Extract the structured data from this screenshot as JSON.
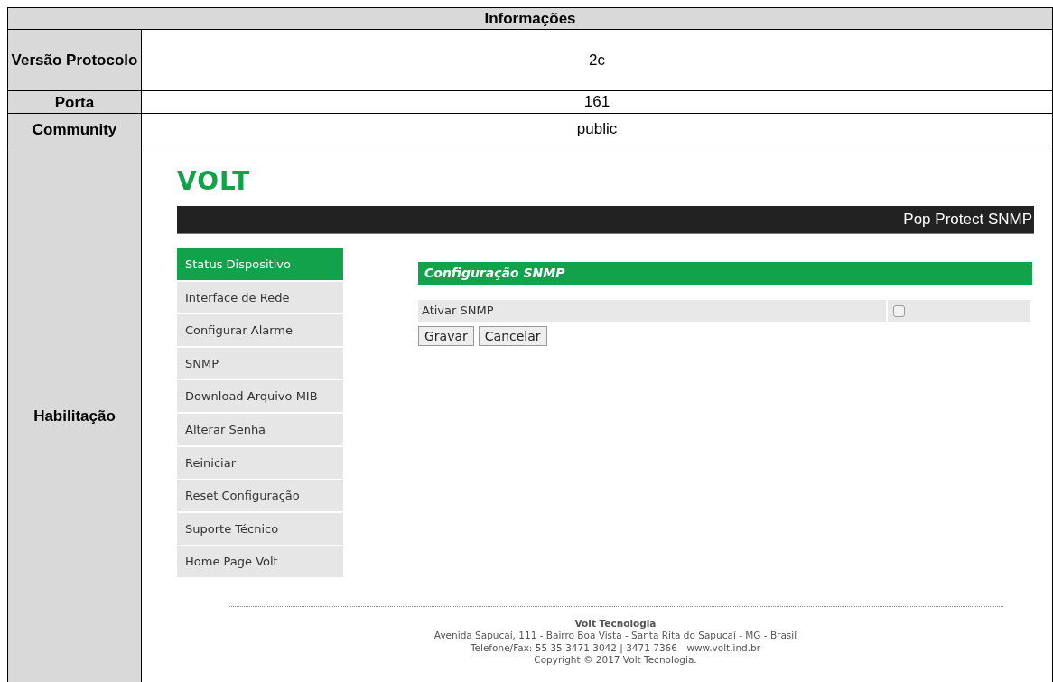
{
  "table": {
    "title": "Informações",
    "rows": [
      {
        "label": "Versão Protocolo",
        "value": "2c"
      },
      {
        "label": "Porta",
        "value": "161"
      },
      {
        "label": "Community",
        "value": "public"
      }
    ],
    "last_row": {
      "label": "Habilitação"
    }
  },
  "web_page": {
    "logo": "VOLT",
    "product": "Pop Protect SNMP",
    "menu": [
      {
        "label": "Status Dispositivo",
        "selected": true
      },
      {
        "label": "Interface de Rede",
        "selected": false
      },
      {
        "label": "Configurar Alarme",
        "selected": false
      },
      {
        "label": "SNMP",
        "selected": false
      },
      {
        "label": "Download Arquivo MIB",
        "selected": false
      },
      {
        "label": "Alterar Senha",
        "selected": false
      },
      {
        "label": "Reiniciar",
        "selected": false
      },
      {
        "label": "Reset Configuração",
        "selected": false
      },
      {
        "label": "Suporte Técnico",
        "selected": false
      },
      {
        "label": "Home Page Volt",
        "selected": false
      }
    ],
    "section_title": "Configuração SNMP",
    "setting": {
      "label": "Ativar SNMP",
      "checked": false
    },
    "buttons": [
      "Gravar",
      "Cancelar"
    ],
    "footer": {
      "company": "Volt Tecnologia",
      "lines": [
        "Avenida Sapucaí, 111 - Bairro Boa Vista - Santa Rita do Sapucaí - MG - Brasil",
        "Telefone/Fax: 55 35 3471 3042 | 3471 7366 - www.volt.ind.br",
        "Copyright © 2017 Volt Tecnologia."
      ]
    }
  }
}
